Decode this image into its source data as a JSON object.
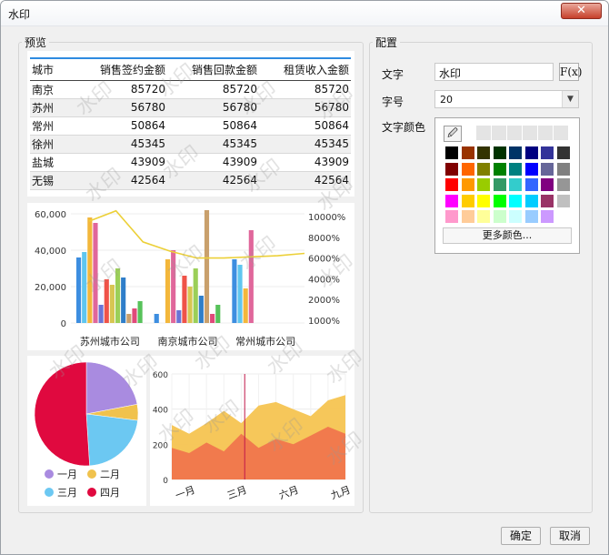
{
  "window": {
    "title": "水印",
    "close_glyph": "✕"
  },
  "preview": {
    "group_title": "预览",
    "table": {
      "headers": [
        "城市",
        "销售签约金额",
        "销售回款金额",
        "租赁收入金额"
      ],
      "rows": [
        [
          "南京",
          "85720",
          "85720",
          "85720"
        ],
        [
          "苏州",
          "56780",
          "56780",
          "56780"
        ],
        [
          "常州",
          "50864",
          "50864",
          "50864"
        ],
        [
          "徐州",
          "45345",
          "45345",
          "45345"
        ],
        [
          "盐城",
          "43909",
          "43909",
          "43909"
        ],
        [
          "无锡",
          "42564",
          "42564",
          "42564"
        ]
      ]
    },
    "watermark_text": "水印"
  },
  "chart_data": [
    {
      "type": "bar",
      "categories": [
        "苏州城市公司",
        "南京城市公司",
        "常州城市公司"
      ],
      "y_ticks": [
        "0",
        "20,000",
        "40,000",
        "60,000"
      ],
      "ylim": [
        0,
        60000
      ],
      "y2_ticks": [
        "1000%",
        "2000%",
        "4000%",
        "6000%",
        "8000%",
        "10000%"
      ],
      "bar_colors": [
        "#3d8ee0",
        "#5fc6ef",
        "#f3b73b",
        "#e0679b",
        "#6b74d6",
        "#ef5348",
        "#d7c652",
        "#9bcf58",
        "#2f7ec9",
        "#c9a06c",
        "#e04a7a",
        "#57c25a"
      ],
      "series_values": [
        [
          36000,
          5000,
          35000
        ],
        [
          39000,
          0,
          32000
        ],
        [
          58000,
          35000,
          19000
        ],
        [
          55000,
          40000,
          51000
        ],
        [
          10000,
          7000,
          0
        ],
        [
          24000,
          26000,
          0
        ],
        [
          21000,
          20000,
          0
        ],
        [
          30000,
          30000,
          0
        ],
        [
          25000,
          15000,
          0
        ],
        [
          5000,
          62000,
          0
        ],
        [
          8000,
          5000,
          0
        ],
        [
          12000,
          10000,
          0
        ]
      ],
      "line": {
        "color": "#ecd038",
        "values": [
          9600,
          10500,
          7800,
          7000,
          6400,
          6400,
          6500,
          6600,
          6800
        ]
      }
    },
    {
      "type": "pie",
      "slices": [
        {
          "label": "一月",
          "value": 22,
          "color": "#a98be0"
        },
        {
          "label": "二月",
          "value": 5,
          "color": "#f0c24d"
        },
        {
          "label": "三月",
          "value": 22,
          "color": "#6cc8f2"
        },
        {
          "label": "四月",
          "value": 51,
          "color": "#e0093f"
        }
      ]
    },
    {
      "type": "area",
      "categories": [
        "一月",
        "三月",
        "六月",
        "九月"
      ],
      "y_ticks": [
        "0",
        "200",
        "400",
        "600"
      ],
      "ylim": [
        0,
        600
      ],
      "series": [
        {
          "values": [
            310,
            260,
            320,
            390,
            320,
            420,
            440,
            400,
            360,
            450,
            480
          ],
          "color": "#f5c451"
        },
        {
          "values": [
            180,
            150,
            210,
            160,
            260,
            180,
            230,
            200,
            250,
            300,
            260
          ],
          "color": "#f0764d"
        }
      ],
      "marker_color": "#c0184a"
    }
  ],
  "config": {
    "group_title": "配置",
    "text_label": "文字",
    "text_value": "水印",
    "fx_label": "F(x)",
    "size_label": "字号",
    "size_value": "20",
    "color_label": "文字颜色",
    "picker_icon": "🖉",
    "more_colors": "更多颜色...",
    "palette": [
      [
        "#000000",
        "#993300",
        "#333300",
        "#003300",
        "#003366",
        "#000080",
        "#333399",
        "#333333"
      ],
      [
        "#800000",
        "#ff6600",
        "#808000",
        "#008000",
        "#008080",
        "#0000ff",
        "#666699",
        "#808080"
      ],
      [
        "#ff0000",
        "#ff9900",
        "#99cc00",
        "#339966",
        "#33cccc",
        "#3366ff",
        "#800080",
        "#969696"
      ],
      [
        "#ff00ff",
        "#ffcc00",
        "#ffff00",
        "#00ff00",
        "#00ffff",
        "#00ccff",
        "#993366",
        "#c0c0c0"
      ],
      [
        "#ff99cc",
        "#ffcc99",
        "#ffff99",
        "#ccffcc",
        "#ccffff",
        "#99ccff",
        "#cc99ff",
        "#ffffff"
      ]
    ]
  },
  "buttons": {
    "ok": "确定",
    "cancel": "取消"
  }
}
